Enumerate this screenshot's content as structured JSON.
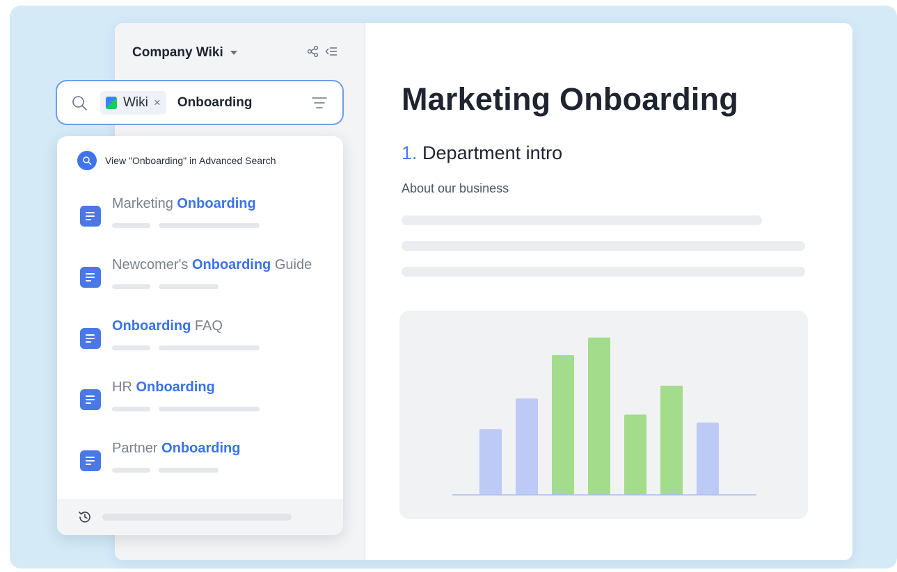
{
  "colors": {
    "accent": "#3a72e8",
    "doc_icon": "#4a78e6",
    "bar_blue": "#bccaf5",
    "bar_green": "#a3dc8a",
    "backdrop": "#d4eaf7"
  },
  "sidebar": {
    "workspace_name": "Company Wiki",
    "share_icon": "share-icon",
    "collapse_icon": "collapse-sidebar-icon"
  },
  "search": {
    "scope_chip": "Wiki",
    "chip_remove": "×",
    "query": "Onboarding",
    "filter_icon": "filter-icon"
  },
  "dropdown": {
    "advanced_search_label": "View \"Onboarding\" in Advanced Search",
    "results": [
      {
        "before": "Marketing ",
        "match": "Onboarding",
        "after": ""
      },
      {
        "before": "Newcomer's ",
        "match": "Onboarding",
        "after": " Guide"
      },
      {
        "before": "",
        "match": "Onboarding",
        "after": " FAQ"
      },
      {
        "before": "HR ",
        "match": "Onboarding",
        "after": ""
      },
      {
        "before": "Partner ",
        "match": "Onboarding",
        "after": ""
      }
    ],
    "footer_icon": "history-icon"
  },
  "document": {
    "title": "Marketing Onboarding",
    "section_number": "1.",
    "section_title": "Department intro",
    "subtitle": "About our business"
  },
  "chart_data": {
    "type": "bar",
    "categories": [
      "",
      "",
      "",
      "",
      "",
      "",
      ""
    ],
    "values": [
      41,
      60,
      87,
      98,
      50,
      68,
      45
    ],
    "series_colors": [
      "blue",
      "blue",
      "green",
      "green",
      "green",
      "green",
      "blue"
    ],
    "ylim": [
      0,
      100
    ],
    "grid": false,
    "legend": "none"
  }
}
